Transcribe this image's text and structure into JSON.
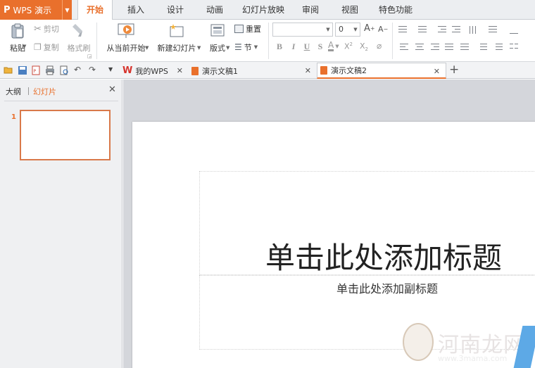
{
  "app": {
    "logo": "P",
    "name": "WPS 演示"
  },
  "menu": {
    "tabs": [
      {
        "label": "开始",
        "active": true
      },
      {
        "label": "插入"
      },
      {
        "label": "设计"
      },
      {
        "label": "动画"
      },
      {
        "label": "幻灯片放映"
      },
      {
        "label": "审阅"
      },
      {
        "label": "视图"
      },
      {
        "label": "特色功能"
      }
    ]
  },
  "ribbon": {
    "paste": "粘贴",
    "cut": "剪切",
    "copy": "复制",
    "format_painter": "格式刷",
    "from_current": "从当前开始",
    "new_slide": "新建幻灯片",
    "layout": "版式",
    "reset": "重置",
    "section": "节",
    "font_name": "",
    "font_size": "0",
    "bold": "B",
    "italic": "I",
    "underline": "U",
    "strike": "S",
    "grow_font": "A",
    "shrink_font": "A"
  },
  "doc_tabs": [
    {
      "label": "我的WPS",
      "icon": "wps-logo-icon"
    },
    {
      "label": "演示文稿1",
      "icon": "presentation-doc-icon"
    },
    {
      "label": "演示文稿2",
      "icon": "presentation-doc-icon",
      "active": true
    }
  ],
  "left_pane": {
    "tabs": [
      "大纲",
      "幻灯片"
    ],
    "active_tab": "幻灯片",
    "slide_numbers": [
      "1"
    ]
  },
  "slide": {
    "title_placeholder": "单击此处添加标题",
    "subtitle_placeholder": "单击此处添加副标题"
  },
  "watermark": {
    "brand": "河南龙网",
    "site": "www.3mama.com"
  },
  "colors": {
    "accent": "#e9702c",
    "workspace_bg": "#d4d6db"
  }
}
